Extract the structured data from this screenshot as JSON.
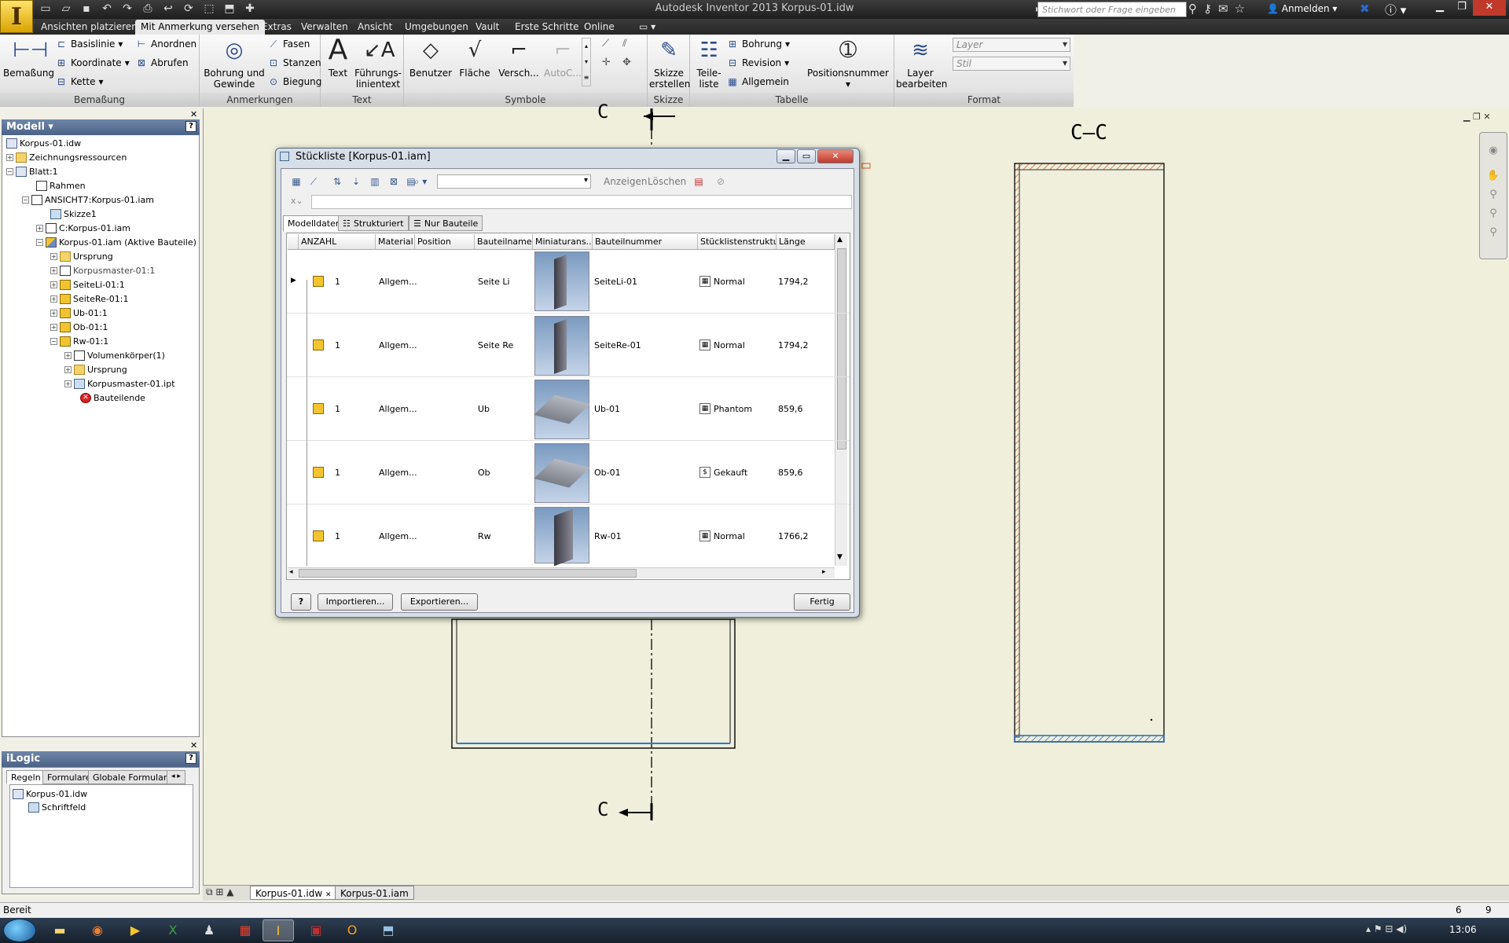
{
  "app": {
    "logo_letter": "I",
    "title": "Autodesk Inventor 2013   Korpus-01.idw",
    "search_placeholder": "Stichwort oder Frage eingeben",
    "login": "Anmelden"
  },
  "ribbon_tabs": [
    "Ansichten platzieren",
    "Mit Anmerkung versehen",
    "Extras",
    "Verwalten",
    "Ansicht",
    "Umgebungen",
    "Vault",
    "Erste Schritte",
    "Online"
  ],
  "ribbon": {
    "bemassung": {
      "label": "Bemaßung",
      "big": "Bemaßung",
      "small": [
        "Basislinie",
        "Koordinate",
        "Kette",
        "Anordnen",
        "Abrufen"
      ]
    },
    "anmerkungen": {
      "label": "Anmerkungen",
      "big_line1": "Bohrung und",
      "big_line2": "Gewinde",
      "small": [
        "Fasen",
        "Stanzen",
        "Biegung"
      ]
    },
    "text": {
      "label": "Text",
      "text_btn": "Text",
      "fuehrung_line1": "Führungs-",
      "fuehrung_line2": "linientext"
    },
    "symbole": {
      "label": "Symbole",
      "items": [
        "Benutzer",
        "Fläche",
        "Versch...",
        "AutoC..."
      ]
    },
    "skizze": {
      "label": "Skizze",
      "line1": "Skizze",
      "line2": "erstellen"
    },
    "tabelle": {
      "label": "Tabelle",
      "teile_line1": "Teile-",
      "teile_line2": "liste",
      "small": [
        "Bohrung",
        "Revision",
        "Allgemein"
      ],
      "positionsnummer": "Positionsnummer"
    },
    "format": {
      "label": "Format",
      "layer_line1": "Layer",
      "layer_line2": "bearbeiten",
      "layer_combo": "Layer",
      "stil_combo": "Stil"
    }
  },
  "browser": {
    "title": "Modell",
    "items": [
      {
        "text": "Korpus-01.idw",
        "icon": "doc"
      },
      {
        "text": "Zeichnungsressourcen",
        "icon": "folder"
      },
      {
        "text": "Blatt:1",
        "icon": "doc"
      },
      {
        "text": "Rahmen",
        "icon": "frame"
      },
      {
        "text": "ANSICHT7:Korpus-01.iam",
        "icon": "frame"
      },
      {
        "text": "Skizze1",
        "icon": "sketch"
      },
      {
        "text": "C:Korpus-01.iam",
        "icon": "frame"
      },
      {
        "text": "Korpus-01.iam (Aktive Bauteile)",
        "icon": "asm"
      },
      {
        "text": "Ursprung",
        "icon": "folder"
      },
      {
        "text": "Korpusmaster-01:1",
        "icon": "frame"
      },
      {
        "text": "SeiteLi-01:1",
        "icon": "cube"
      },
      {
        "text": "SeiteRe-01:1",
        "icon": "cube"
      },
      {
        "text": "Ub-01:1",
        "icon": "cube"
      },
      {
        "text": "Ob-01:1",
        "icon": "cube"
      },
      {
        "text": "Rw-01:1",
        "icon": "cube"
      },
      {
        "text": "Volumenkörper(1)",
        "icon": "frame"
      },
      {
        "text": "Ursprung",
        "icon": "folder"
      },
      {
        "text": "Korpusmaster-01.ipt",
        "icon": "sketch"
      },
      {
        "text": "Bauteilende",
        "icon": "err"
      }
    ]
  },
  "ilogic": {
    "title": "iLogic",
    "tabs": [
      "Regeln",
      "Formulare",
      "Globale Formulare"
    ],
    "items": [
      "Korpus-01.idw",
      "Schriftfeld"
    ]
  },
  "drawing": {
    "section_title": "C–C",
    "cut_label_top": "C",
    "cut_label_bottom": "C"
  },
  "doc_tabs": [
    "Korpus-01.idw",
    "Korpus-01.iam"
  ],
  "status": {
    "text": "Bereit",
    "num1": "6",
    "num2": "9"
  },
  "taskbar": {
    "clock": "13:06"
  },
  "dialog": {
    "title": "Stückliste [Korpus-01.iam]",
    "toolbar_show": "Anzeigen",
    "toolbar_delete": "Löschen",
    "tabs": [
      "Modelldaten",
      "Strukturiert",
      "Nur Bauteile"
    ],
    "columns": [
      "ANZAHL",
      "Material",
      "Position",
      "Bauteilnamen",
      "Miniaturans...",
      "Bauteilnummer",
      "Stücklistenstruktur",
      "Länge"
    ],
    "rows": [
      {
        "anzahl": "1",
        "material": "Allgem...",
        "position": "",
        "name": "Seite Li",
        "thumb": "vertical",
        "nummer": "SeiteLi-01",
        "struktur": "Normal",
        "laenge": "1794,2"
      },
      {
        "anzahl": "1",
        "material": "Allgem...",
        "position": "",
        "name": "Seite Re",
        "thumb": "vertical",
        "nummer": "SeiteRe-01",
        "struktur": "Normal",
        "laenge": "1794,2"
      },
      {
        "anzahl": "1",
        "material": "Allgem...",
        "position": "",
        "name": "Ub",
        "thumb": "horizontal",
        "nummer": "Ub-01",
        "struktur": "Phantom",
        "laenge": "859,6"
      },
      {
        "anzahl": "1",
        "material": "Allgem...",
        "position": "",
        "name": "Ob",
        "thumb": "horizontal",
        "nummer": "Ob-01",
        "struktur": "Gekauft",
        "laenge": "859,6"
      },
      {
        "anzahl": "1",
        "material": "Allgem...",
        "position": "",
        "name": "Rw",
        "thumb": "vertical",
        "nummer": "Rw-01",
        "struktur": "Normal",
        "laenge": "1766,2"
      }
    ],
    "import_btn": "Importieren...",
    "export_btn": "Exportieren...",
    "done_btn": "Fertig"
  },
  "colors": {
    "canvas": "#efefdc",
    "ribbon_dark": "#2b2b2b",
    "hatch": "#d65a2a",
    "highlight_blue": "#2a7ad0"
  }
}
